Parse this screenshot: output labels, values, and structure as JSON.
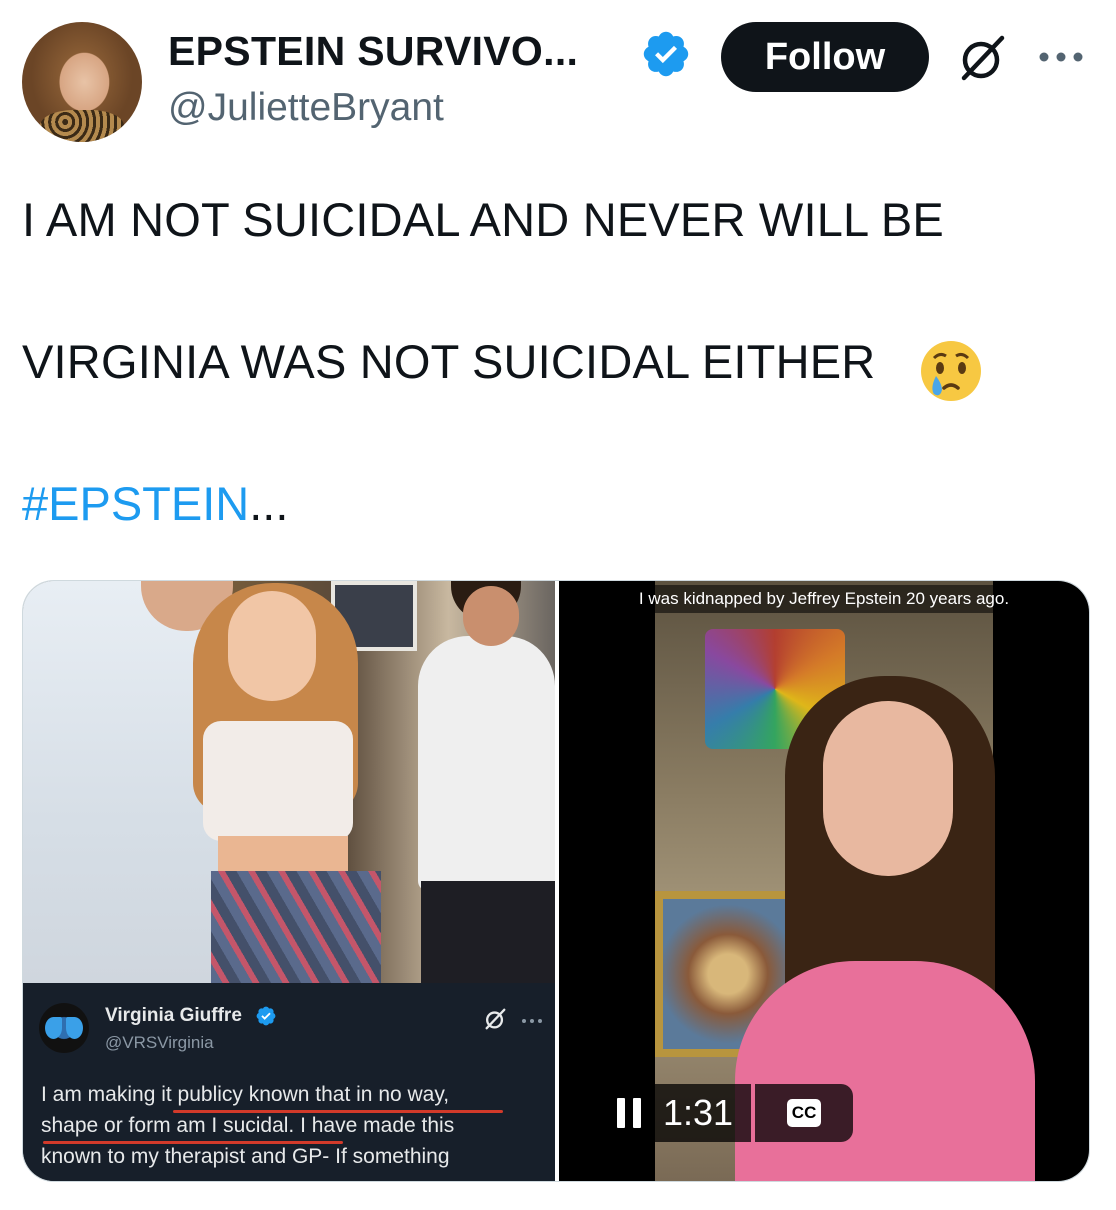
{
  "author": {
    "display_name": "EPSTEIN SURVIVO...",
    "handle": "@JulietteBryant",
    "verified": true
  },
  "actions": {
    "follow_label": "Follow",
    "grok_icon": "grok-icon",
    "more_icon": "more-icon"
  },
  "tweet": {
    "line1": "I AM NOT SUICIDAL AND NEVER WILL BE",
    "line2": "VIRGINIA WAS NOT SUICIDAL EITHER",
    "emoji": "crying-face",
    "hashtag": "#EPSTEIN",
    "ellipsis": "..."
  },
  "media": {
    "embedded_post": {
      "name": "Virginia Giuffre",
      "handle": "@VRSVirginia",
      "text_lines": [
        "I am making it publicy known that in no way,",
        "shape or form am I sucidal. I have made this",
        "known to my therapist and GP- If something"
      ]
    },
    "video": {
      "caption": "I was kidnapped by Jeffrey Epstein 20 years ago.",
      "time": "1:31",
      "cc_label": "CC"
    }
  },
  "colors": {
    "link": "#1d9bf0",
    "verified": "#1d9bf0",
    "text": "#0f1419",
    "secondary": "#536471"
  }
}
